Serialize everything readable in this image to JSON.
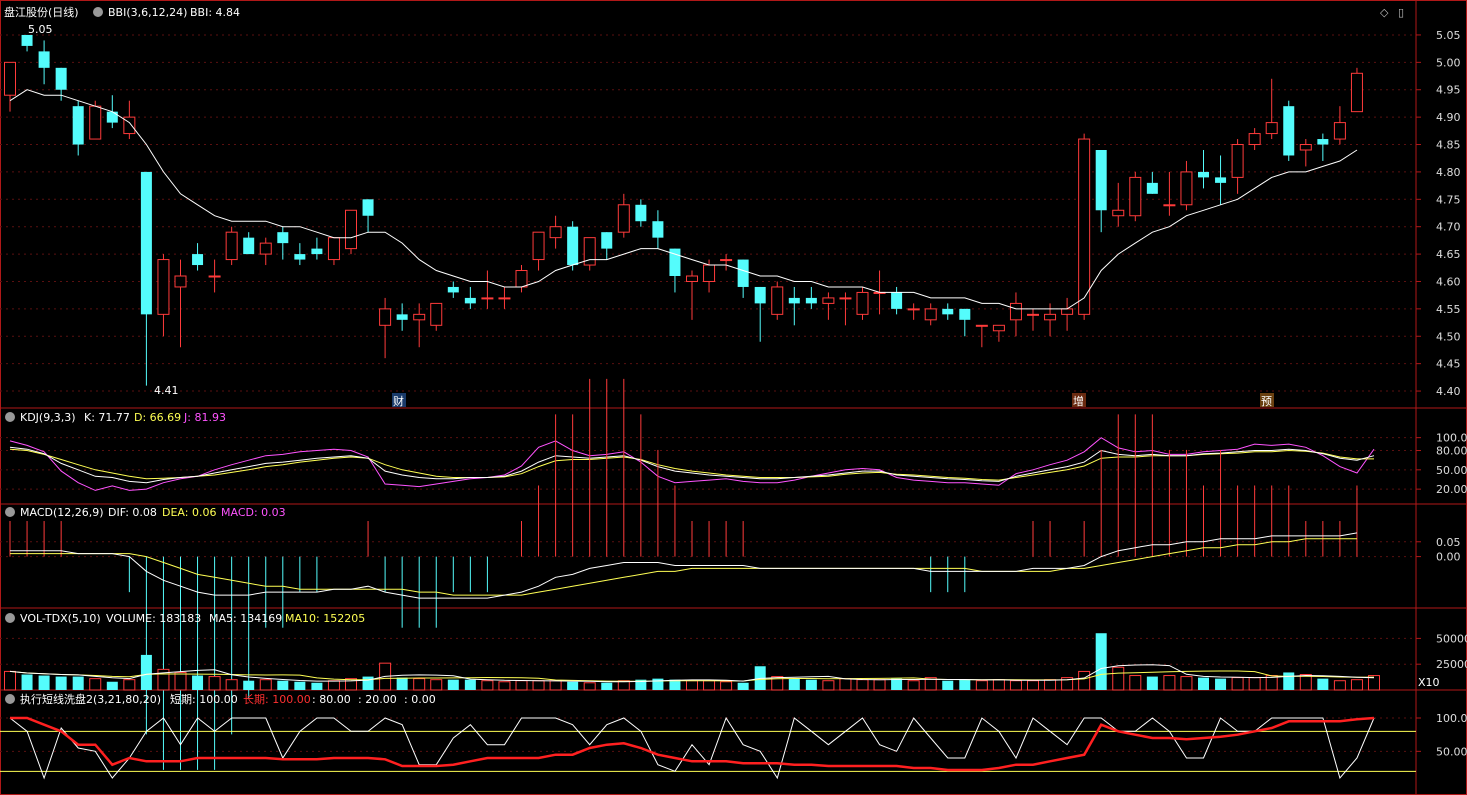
{
  "colors": {
    "up": "#ff3b3b",
    "down": "#54fcfc",
    "white": "#ffffff",
    "yellow": "#ffff54",
    "magenta": "#ff54ff",
    "red_line": "#ff2020",
    "frame": "#b01818",
    "grid": "#5a1010"
  },
  "header": {
    "name": "盘江股份(日线)",
    "bbi_label": "BBI(3,6,12,24)",
    "bbi_value": "BBI: 4.84",
    "diamond_icon": "◇",
    "save_icon": "▯"
  },
  "markers": {
    "cai": "财",
    "zeng": "增",
    "yu": "预"
  },
  "price_labels": {
    "high": "5.05",
    "low": "4.41"
  },
  "kdj_header": {
    "name": "KDJ(9,3,3)",
    "k": "K: 71.77",
    "d": "D: 66.69",
    "j": "J: 81.93"
  },
  "macd_header": {
    "name": "MACD(12,26,9)",
    "dif": "DIF: 0.08",
    "dea": "DEA: 0.06",
    "macd": "MACD: 0.03"
  },
  "vol_header": {
    "name": "VOL-TDX(5,10)",
    "volume": "VOLUME: 183183",
    "ma5": "MA5: 134169",
    "ma10": "MA10: 152205"
  },
  "exec_header": {
    "name": "执行短线洗盘2(3,21,80,20)",
    "short": "短期: 100.00",
    "long": "长期: 100.00",
    "l80": ": 80.00",
    "l20": ": 20.00",
    "l0": ": 0.00"
  },
  "vol_unit": "X10",
  "chart_data": {
    "type": "candlestick",
    "price_axis": {
      "ticks": [
        "5.05",
        "5.00",
        "4.95",
        "4.90",
        "4.85",
        "4.80",
        "4.75",
        "4.70",
        "4.65",
        "4.60",
        "4.55",
        "4.50",
        "4.45",
        "4.40"
      ],
      "ylim": [
        4.38,
        5.07
      ]
    },
    "ohlc": [
      [
        4.94,
        5.0,
        4.91,
        5.0
      ],
      [
        5.05,
        5.05,
        5.02,
        5.03
      ],
      [
        5.02,
        5.04,
        4.96,
        4.99
      ],
      [
        4.99,
        4.99,
        4.93,
        4.95
      ],
      [
        4.92,
        4.93,
        4.83,
        4.85
      ],
      [
        4.86,
        4.93,
        4.86,
        4.92
      ],
      [
        4.91,
        4.94,
        4.88,
        4.89
      ],
      [
        4.87,
        4.93,
        4.86,
        4.9
      ],
      [
        4.8,
        4.8,
        4.41,
        4.54
      ],
      [
        4.54,
        4.65,
        4.5,
        4.64
      ],
      [
        4.59,
        4.64,
        4.48,
        4.61
      ],
      [
        4.65,
        4.67,
        4.62,
        4.63
      ],
      [
        4.61,
        4.64,
        4.58,
        4.61
      ],
      [
        4.64,
        4.7,
        4.63,
        4.69
      ],
      [
        4.68,
        4.69,
        4.65,
        4.65
      ],
      [
        4.65,
        4.68,
        4.63,
        4.67
      ],
      [
        4.69,
        4.7,
        4.64,
        4.67
      ],
      [
        4.65,
        4.67,
        4.63,
        4.64
      ],
      [
        4.66,
        4.68,
        4.64,
        4.65
      ],
      [
        4.64,
        4.68,
        4.63,
        4.68
      ],
      [
        4.66,
        4.73,
        4.65,
        4.73
      ],
      [
        4.75,
        4.75,
        4.69,
        4.72
      ],
      [
        4.52,
        4.57,
        4.46,
        4.55
      ],
      [
        4.54,
        4.56,
        4.51,
        4.53
      ],
      [
        4.53,
        4.56,
        4.48,
        4.54
      ],
      [
        4.52,
        4.56,
        4.51,
        4.56
      ],
      [
        4.59,
        4.6,
        4.57,
        4.58
      ],
      [
        4.57,
        4.59,
        4.55,
        4.56
      ],
      [
        4.57,
        4.62,
        4.55,
        4.57
      ],
      [
        4.57,
        4.59,
        4.55,
        4.57
      ],
      [
        4.59,
        4.63,
        4.58,
        4.62
      ],
      [
        4.64,
        4.69,
        4.62,
        4.69
      ],
      [
        4.68,
        4.72,
        4.66,
        4.7
      ],
      [
        4.7,
        4.71,
        4.62,
        4.63
      ],
      [
        4.63,
        4.68,
        4.62,
        4.68
      ],
      [
        4.69,
        4.69,
        4.64,
        4.66
      ],
      [
        4.69,
        4.76,
        4.68,
        4.74
      ],
      [
        4.74,
        4.75,
        4.7,
        4.71
      ],
      [
        4.71,
        4.73,
        4.66,
        4.68
      ],
      [
        4.66,
        4.66,
        4.58,
        4.61
      ],
      [
        4.6,
        4.62,
        4.53,
        4.61
      ],
      [
        4.6,
        4.64,
        4.58,
        4.63
      ],
      [
        4.64,
        4.65,
        4.62,
        4.64
      ],
      [
        4.64,
        4.64,
        4.57,
        4.59
      ],
      [
        4.59,
        4.59,
        4.49,
        4.56
      ],
      [
        4.54,
        4.6,
        4.53,
        4.59
      ],
      [
        4.57,
        4.59,
        4.52,
        4.56
      ],
      [
        4.57,
        4.59,
        4.55,
        4.56
      ],
      [
        4.56,
        4.58,
        4.53,
        4.57
      ],
      [
        4.57,
        4.58,
        4.52,
        4.57
      ],
      [
        4.54,
        4.59,
        4.53,
        4.58
      ],
      [
        4.58,
        4.62,
        4.54,
        4.58
      ],
      [
        4.58,
        4.59,
        4.54,
        4.55
      ],
      [
        4.55,
        4.56,
        4.53,
        4.55
      ],
      [
        4.53,
        4.56,
        4.52,
        4.55
      ],
      [
        4.55,
        4.56,
        4.53,
        4.54
      ],
      [
        4.55,
        4.55,
        4.5,
        4.53
      ],
      [
        4.52,
        4.52,
        4.48,
        4.52
      ],
      [
        4.51,
        4.52,
        4.49,
        4.52
      ],
      [
        4.53,
        4.58,
        4.5,
        4.56
      ],
      [
        4.54,
        4.55,
        4.51,
        4.54
      ],
      [
        4.53,
        4.56,
        4.5,
        4.54
      ],
      [
        4.54,
        4.57,
        4.51,
        4.55
      ],
      [
        4.54,
        4.87,
        4.53,
        4.86
      ],
      [
        4.84,
        4.84,
        4.69,
        4.73
      ],
      [
        4.72,
        4.78,
        4.7,
        4.73
      ],
      [
        4.72,
        4.8,
        4.71,
        4.79
      ],
      [
        4.78,
        4.8,
        4.76,
        4.76
      ],
      [
        4.74,
        4.8,
        4.72,
        4.74
      ],
      [
        4.74,
        4.82,
        4.73,
        4.8
      ],
      [
        4.8,
        4.84,
        4.77,
        4.79
      ],
      [
        4.79,
        4.83,
        4.74,
        4.78
      ],
      [
        4.79,
        4.86,
        4.76,
        4.85
      ],
      [
        4.85,
        4.88,
        4.84,
        4.87
      ],
      [
        4.87,
        4.97,
        4.86,
        4.89
      ],
      [
        4.92,
        4.93,
        4.82,
        4.83
      ],
      [
        4.84,
        4.86,
        4.81,
        4.85
      ],
      [
        4.86,
        4.87,
        4.82,
        4.85
      ],
      [
        4.86,
        4.92,
        4.85,
        4.89
      ],
      [
        4.91,
        4.99,
        4.91,
        4.98
      ]
    ],
    "bbi": [
      4.93,
      4.95,
      4.94,
      4.94,
      4.93,
      4.92,
      4.91,
      4.89,
      4.85,
      4.8,
      4.76,
      4.74,
      4.72,
      4.71,
      4.71,
      4.71,
      4.7,
      4.7,
      4.69,
      4.68,
      4.68,
      4.69,
      4.69,
      4.67,
      4.64,
      4.62,
      4.61,
      4.6,
      4.6,
      4.59,
      4.59,
      4.6,
      4.62,
      4.63,
      4.64,
      4.64,
      4.65,
      4.66,
      4.66,
      4.65,
      4.64,
      4.63,
      4.63,
      4.62,
      4.61,
      4.61,
      4.6,
      4.6,
      4.59,
      4.59,
      4.59,
      4.58,
      4.58,
      4.58,
      4.57,
      4.57,
      4.57,
      4.56,
      4.56,
      4.55,
      4.55,
      4.55,
      4.55,
      4.57,
      4.62,
      4.65,
      4.67,
      4.69,
      4.7,
      4.72,
      4.73,
      4.74,
      4.75,
      4.77,
      4.79,
      4.8,
      4.8,
      4.81,
      4.82,
      4.84
    ],
    "volume": [
      18000,
      15000,
      14000,
      13000,
      13000,
      11000,
      8000,
      10000,
      34000,
      20000,
      17000,
      14000,
      13000,
      10000,
      9000,
      10000,
      9000,
      8000,
      7000,
      9000,
      11000,
      13000,
      26000,
      12000,
      11000,
      10000,
      10000,
      10000,
      9000,
      8000,
      9000,
      9000,
      9000,
      8000,
      7000,
      7000,
      9000,
      10000,
      11000,
      10000,
      9000,
      9000,
      8000,
      7000,
      23000,
      13000,
      11000,
      10000,
      9000,
      11000,
      10000,
      10000,
      11000,
      9000,
      12000,
      9000,
      10000,
      9000,
      10000,
      9000,
      9000,
      10000,
      12000,
      18000,
      55000,
      22000,
      14000,
      13000,
      14000,
      13000,
      12000,
      11000,
      12000,
      12000,
      14000,
      17000,
      15000,
      11000,
      9000,
      10000,
      14000
    ],
    "vol_axis": {
      "ticks": [
        "50000",
        "25000"
      ],
      "ylim": [
        0,
        62000
      ]
    },
    "kdj": {
      "k": [
        85,
        82,
        75,
        60,
        50,
        40,
        38,
        32,
        30,
        35,
        38,
        40,
        45,
        50,
        55,
        60,
        62,
        65,
        68,
        70,
        72,
        68,
        48,
        42,
        38,
        36,
        36,
        38,
        38,
        40,
        48,
        62,
        72,
        70,
        68,
        70,
        72,
        65,
        55,
        48,
        45,
        42,
        40,
        38,
        36,
        36,
        38,
        40,
        42,
        45,
        48,
        48,
        42,
        40,
        38,
        36,
        35,
        33,
        32,
        40,
        45,
        50,
        55,
        62,
        80,
        74,
        72,
        74,
        72,
        72,
        75,
        76,
        78,
        80,
        80,
        82,
        80,
        75,
        68,
        65,
        72
      ],
      "d": [
        82,
        80,
        74,
        66,
        58,
        50,
        45,
        40,
        36,
        37,
        38,
        40,
        42,
        46,
        50,
        55,
        58,
        62,
        65,
        68,
        70,
        68,
        58,
        50,
        45,
        40,
        38,
        38,
        38,
        39,
        44,
        55,
        64,
        66,
        66,
        68,
        70,
        66,
        58,
        52,
        48,
        45,
        42,
        40,
        38,
        38,
        38,
        39,
        40,
        43,
        45,
        46,
        43,
        42,
        40,
        38,
        37,
        35,
        34,
        38,
        42,
        46,
        50,
        56,
        68,
        70,
        70,
        72,
        72,
        72,
        74,
        75,
        76,
        78,
        78,
        80,
        79,
        76,
        70,
        67,
        67
      ],
      "j": [
        95,
        88,
        78,
        48,
        30,
        18,
        25,
        18,
        20,
        30,
        36,
        40,
        50,
        58,
        65,
        72,
        74,
        78,
        80,
        82,
        80,
        70,
        28,
        26,
        24,
        28,
        32,
        36,
        38,
        42,
        56,
        85,
        95,
        80,
        72,
        74,
        78,
        62,
        40,
        30,
        32,
        34,
        36,
        32,
        30,
        30,
        34,
        40,
        45,
        50,
        52,
        50,
        38,
        34,
        32,
        30,
        30,
        28,
        26,
        44,
        50,
        58,
        65,
        78,
        100,
        84,
        78,
        80,
        74,
        74,
        78,
        80,
        82,
        90,
        88,
        90,
        85,
        72,
        55,
        45,
        82
      ],
      "axis_ticks": [
        "100.00",
        "80.00",
        "50.00",
        "20.00"
      ],
      "ylim": [
        0,
        115
      ]
    },
    "macd": {
      "dif": [
        0.02,
        0.02,
        0.02,
        0.02,
        0.01,
        0.01,
        0.01,
        0.0,
        -0.05,
        -0.08,
        -0.1,
        -0.12,
        -0.13,
        -0.13,
        -0.13,
        -0.12,
        -0.12,
        -0.12,
        -0.12,
        -0.11,
        -0.11,
        -0.1,
        -0.12,
        -0.13,
        -0.14,
        -0.14,
        -0.14,
        -0.14,
        -0.14,
        -0.13,
        -0.12,
        -0.1,
        -0.07,
        -0.06,
        -0.04,
        -0.03,
        -0.02,
        -0.02,
        -0.02,
        -0.03,
        -0.03,
        -0.03,
        -0.03,
        -0.03,
        -0.04,
        -0.04,
        -0.04,
        -0.04,
        -0.04,
        -0.04,
        -0.04,
        -0.04,
        -0.04,
        -0.04,
        -0.05,
        -0.05,
        -0.05,
        -0.05,
        -0.05,
        -0.05,
        -0.04,
        -0.04,
        -0.04,
        -0.03,
        0.0,
        0.02,
        0.03,
        0.04,
        0.04,
        0.05,
        0.05,
        0.06,
        0.06,
        0.06,
        0.07,
        0.07,
        0.07,
        0.07,
        0.07,
        0.08
      ],
      "dea": [
        0.01,
        0.01,
        0.01,
        0.01,
        0.01,
        0.01,
        0.01,
        0.01,
        0.0,
        -0.02,
        -0.04,
        -0.06,
        -0.07,
        -0.08,
        -0.09,
        -0.1,
        -0.1,
        -0.11,
        -0.11,
        -0.11,
        -0.11,
        -0.11,
        -0.11,
        -0.11,
        -0.12,
        -0.12,
        -0.13,
        -0.13,
        -0.13,
        -0.13,
        -0.13,
        -0.12,
        -0.11,
        -0.1,
        -0.09,
        -0.08,
        -0.07,
        -0.06,
        -0.05,
        -0.05,
        -0.04,
        -0.04,
        -0.04,
        -0.04,
        -0.04,
        -0.04,
        -0.04,
        -0.04,
        -0.04,
        -0.04,
        -0.04,
        -0.04,
        -0.04,
        -0.04,
        -0.04,
        -0.04,
        -0.04,
        -0.05,
        -0.05,
        -0.05,
        -0.05,
        -0.05,
        -0.04,
        -0.04,
        -0.03,
        -0.02,
        -0.01,
        0.0,
        0.01,
        0.02,
        0.03,
        0.03,
        0.04,
        0.04,
        0.05,
        0.05,
        0.06,
        0.06,
        0.06,
        0.06
      ],
      "axis_ticks": [
        "0.05",
        "0.00"
      ],
      "ylim": [
        -0.16,
        0.11
      ]
    },
    "exec": {
      "short": [
        100,
        80,
        10,
        85,
        55,
        50,
        10,
        40,
        80,
        100,
        60,
        100,
        80,
        100,
        100,
        100,
        40,
        80,
        100,
        100,
        80,
        80,
        100,
        90,
        30,
        30,
        70,
        90,
        60,
        60,
        100,
        100,
        100,
        90,
        60,
        90,
        100,
        80,
        30,
        20,
        60,
        30,
        100,
        60,
        50,
        10,
        100,
        80,
        60,
        80,
        100,
        60,
        50,
        100,
        70,
        40,
        40,
        100,
        80,
        40,
        100,
        80,
        60,
        100,
        100,
        80,
        80,
        100,
        80,
        40,
        40,
        100,
        80,
        80,
        100,
        100,
        100,
        100,
        10,
        40,
        100
      ],
      "long": [
        100,
        100,
        90,
        80,
        60,
        60,
        30,
        40,
        35,
        35,
        35,
        40,
        40,
        40,
        40,
        40,
        38,
        38,
        38,
        40,
        40,
        40,
        38,
        28,
        28,
        28,
        30,
        35,
        40,
        40,
        40,
        40,
        45,
        45,
        55,
        60,
        62,
        55,
        45,
        40,
        35,
        35,
        35,
        32,
        32,
        32,
        30,
        30,
        28,
        28,
        28,
        28,
        28,
        25,
        25,
        22,
        22,
        22,
        25,
        30,
        30,
        35,
        40,
        45,
        90,
        80,
        75,
        70,
        70,
        68,
        70,
        72,
        75,
        80,
        85,
        95,
        95,
        95,
        95,
        98,
        100
      ],
      "lines": [
        80,
        20
      ],
      "axis_ticks": [
        "100.0",
        "50.00"
      ],
      "ylim": [
        -2,
        115
      ]
    }
  }
}
